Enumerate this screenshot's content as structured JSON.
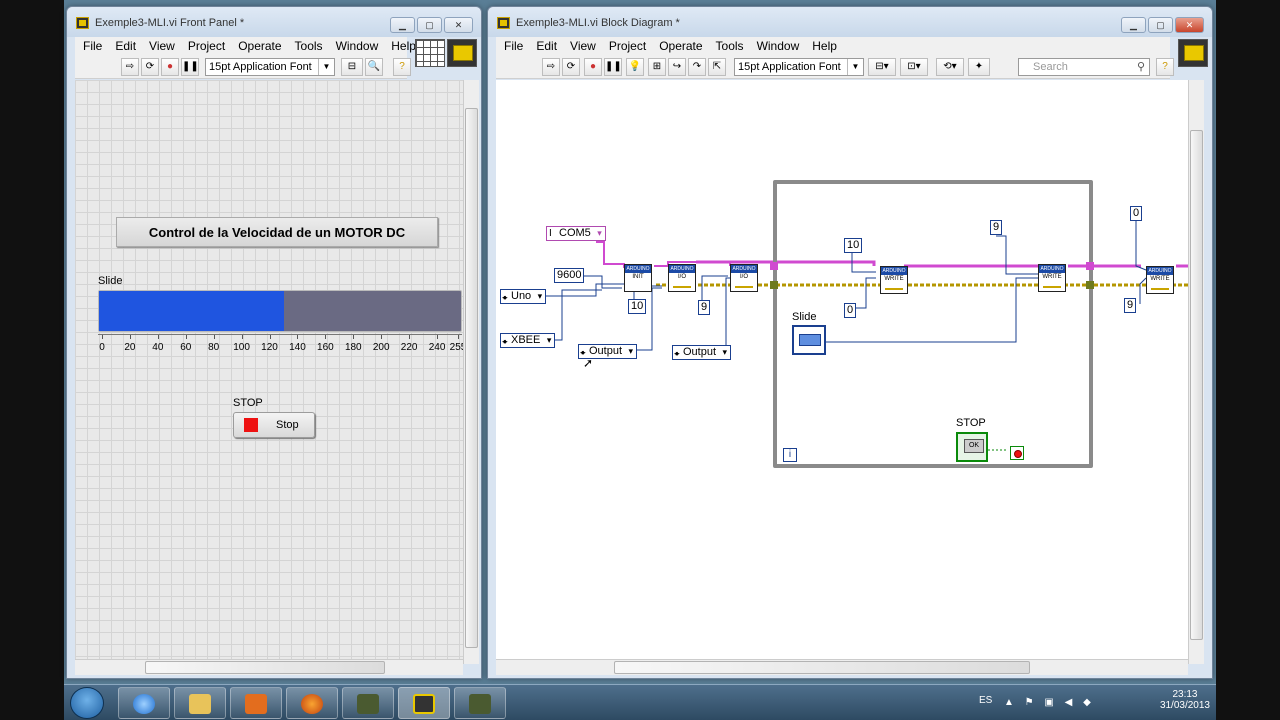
{
  "front_panel": {
    "title": "Exemple3-MLI.vi Front Panel *",
    "menus": [
      "File",
      "Edit",
      "View",
      "Project",
      "Operate",
      "Tools",
      "Window",
      "Help"
    ],
    "font_select": "15pt Application Font",
    "title_text": "Control de la Velocidad de un MOTOR DC",
    "slide": {
      "label": "Slide",
      "value": 130,
      "max": 255,
      "ticks": [
        "0",
        "20",
        "40",
        "60",
        "80",
        "100",
        "120",
        "140",
        "160",
        "180",
        "200",
        "220",
        "240",
        "255"
      ]
    },
    "stop": {
      "label": "STOP",
      "button_text": "Stop"
    }
  },
  "block_diagram": {
    "title": "Exemple3-MLI.vi Block Diagram *",
    "menus": [
      "File",
      "Edit",
      "View",
      "Project",
      "Operate",
      "Tools",
      "Window",
      "Help"
    ],
    "font_select": "15pt Application Font",
    "search_placeholder": "Search",
    "visa_resource": "COM5",
    "baud": "9600",
    "board_ring": "Uno",
    "conn_ring": "XBEE",
    "output_ring_1": "Output",
    "output_ring_2": "Output",
    "const_10a": "10",
    "const_9a": "9",
    "const_10b": "10",
    "const_0a": "0",
    "const_9b": "9",
    "const_0b": "0",
    "const_9c": "9",
    "slide_label": "Slide",
    "stop_label": "STOP",
    "iteration": "i",
    "sub_init": "INIT",
    "sub_io": "I/O",
    "sub_write": "WRITE"
  },
  "taskbar": {
    "language": "ES",
    "time": "23:13",
    "date": "31/03/2013"
  },
  "colors": {
    "slide_fill": "#1f55e0",
    "slide_track": "#6a6a83",
    "stop_red": "#ee1111",
    "visa_wire": "#d04ad0",
    "error_wire": "#b49600",
    "numeric_wire": "#1a3f8f"
  }
}
